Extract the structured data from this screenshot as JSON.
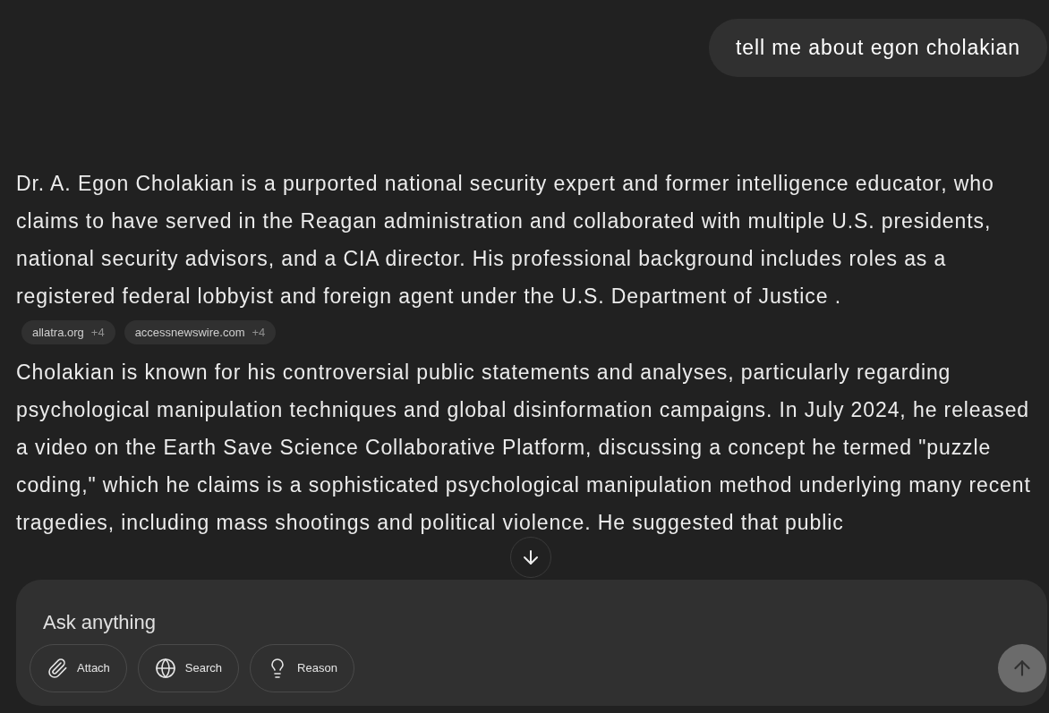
{
  "user_message": "tell me about egon cholakian",
  "answer": [
    {
      "text": "Dr. A. Egon Cholakian is a purported national security expert and former intelligence educator, who claims to have served in the Reagan administration and collaborated with multiple U.S. presidents, national security advisors, and a CIA director. His professional background includes roles as a registered federal lobbyist and foreign agent under the U.S. Department of Justice .",
      "sources": [
        {
          "site": "allatra.org",
          "more": "+4"
        },
        {
          "site": "accessnewswire.com",
          "more": "+4"
        }
      ]
    },
    {
      "text": "Cholakian is known for his controversial public statements and analyses, particularly regarding psychological manipulation techniques and global disinformation campaigns. In July 2024, he released a video on the Earth Save Science Collaborative Platform, discussing a concept he termed \"puzzle coding,\" which he claims is a sophisticated psychological manipulation method underlying many recent tragedies, including mass shootings and political violence. He suggested that public"
    }
  ],
  "composer": {
    "placeholder": "Ask anything",
    "tools": [
      {
        "kind": "attach",
        "label": "Attach"
      },
      {
        "kind": "search",
        "label": "Search"
      },
      {
        "kind": "reason",
        "label": "Reason"
      }
    ],
    "send_disabled": true
  }
}
